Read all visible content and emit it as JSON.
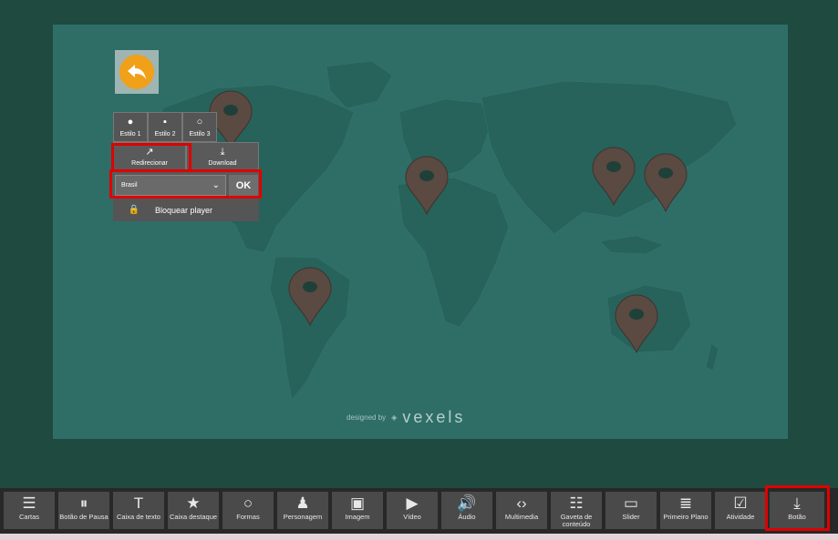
{
  "colors": {
    "page_bg": "#1f4a40",
    "stage_bg": "#2e6e67",
    "land": "#27625b",
    "pin": "#5a4a42",
    "highlight": "#e00000",
    "back_button": "#f0a019"
  },
  "player": {
    "back_icon": "reply-arrow-icon",
    "styles": [
      {
        "label": "Estilo 1",
        "icon": "filled-circle-icon",
        "glyph": "●"
      },
      {
        "label": "Estilo 2",
        "icon": "small-square-icon",
        "glyph": "▪"
      },
      {
        "label": "Estilo 3",
        "icon": "outline-circle-icon",
        "glyph": "○"
      }
    ],
    "actions": [
      {
        "label": "Redirecionar",
        "icon": "external-link-icon",
        "glyph": "↗"
      },
      {
        "label": "Download",
        "icon": "download-icon",
        "glyph": "⤓"
      }
    ],
    "select_value": "Brasil",
    "ok_label": "OK",
    "lock_label": "Bloquear player",
    "lock_glyph": "🔒"
  },
  "credit": {
    "designed_by": "designed by",
    "brand": "vexels"
  },
  "toolbar": {
    "items": [
      {
        "label": "Cartas",
        "icon": "cards-icon",
        "glyph": "☰"
      },
      {
        "label": "Botão de Pausa",
        "icon": "pause-icon",
        "glyph": "⏸"
      },
      {
        "label": "Caixa de texto",
        "icon": "text-icon",
        "glyph": "T"
      },
      {
        "label": "Caixa destaque",
        "icon": "star-icon",
        "glyph": "★"
      },
      {
        "label": "Formas",
        "icon": "shape-circle-icon",
        "glyph": "○"
      },
      {
        "label": "Personagem",
        "icon": "character-icon",
        "glyph": "♟"
      },
      {
        "label": "Imagem",
        "icon": "image-icon",
        "glyph": "▣"
      },
      {
        "label": "Vídeo",
        "icon": "video-icon",
        "glyph": "▶"
      },
      {
        "label": "Áudio",
        "icon": "audio-icon",
        "glyph": "🔊"
      },
      {
        "label": "Multimedia",
        "icon": "code-icon",
        "glyph": "‹›"
      },
      {
        "label": "Gaveta de conteúdo",
        "icon": "drawer-icon",
        "glyph": "☷"
      },
      {
        "label": "Slider",
        "icon": "slider-icon",
        "glyph": "▭"
      },
      {
        "label": "Primeiro Plano",
        "icon": "foreground-icon",
        "glyph": "≣"
      },
      {
        "label": "Atividade",
        "icon": "checklist-icon",
        "glyph": "☑"
      },
      {
        "label": "Botão",
        "icon": "button-download-icon",
        "glyph": "⤓"
      }
    ]
  }
}
